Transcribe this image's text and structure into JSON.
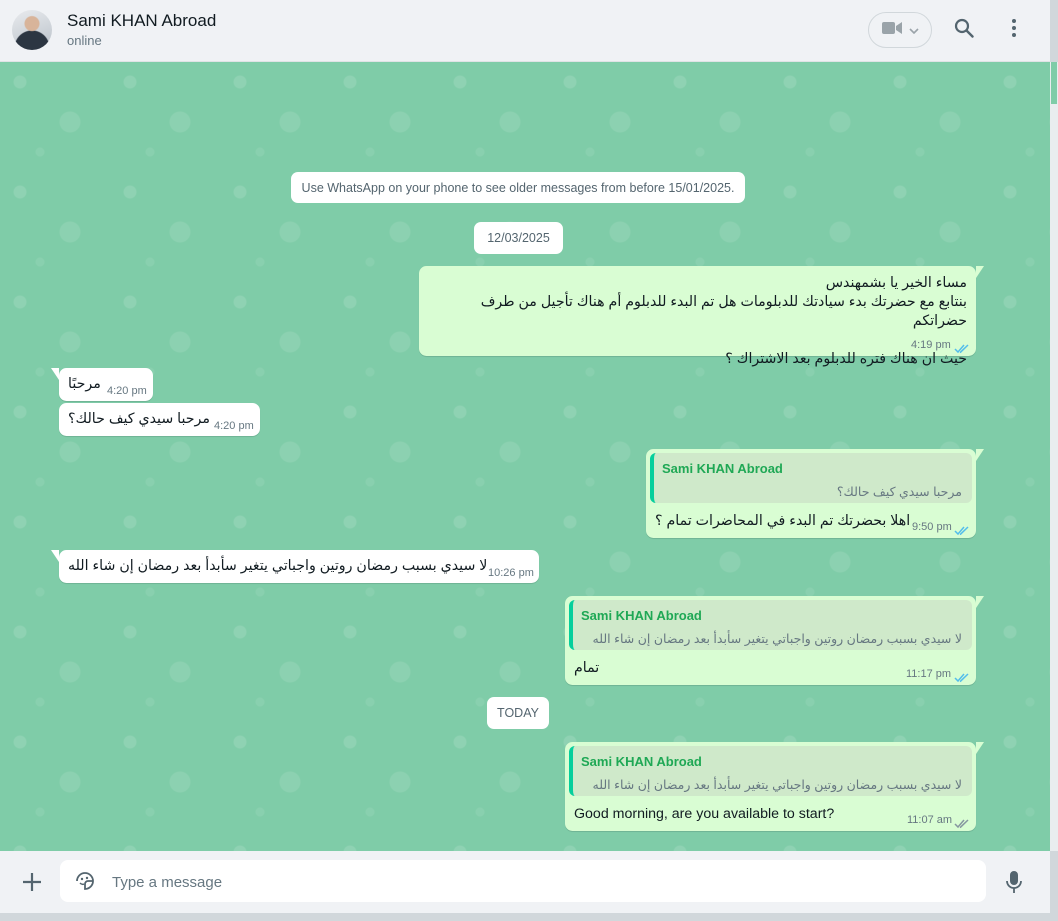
{
  "header": {
    "contact_name": "Sami KHAN Abroad",
    "status": "online"
  },
  "notice": "Use WhatsApp on your phone to see older messages from before 15/01/2025.",
  "date_chips": [
    "12/03/2025",
    "TODAY"
  ],
  "messages": [
    {
      "direction": "outgoing",
      "lines": [
        "مساء الخير يا بشمهندس",
        "بنتابع مع حضرتك بدء سيادتك للدبلومات هل تم البدء للدبلوم أم هناك تأجيل من طرف حضراتكم",
        "",
        "حيث ان هناك فتره للدبلوم بعد الاشتراك ؟"
      ],
      "time": "4:19 pm",
      "status": "read"
    },
    {
      "direction": "incoming",
      "text": "مرحبًا",
      "time": "4:20 pm"
    },
    {
      "direction": "incoming",
      "text": "مرحبا سيدي كيف حالك؟",
      "time": "4:20 pm"
    },
    {
      "direction": "outgoing",
      "quote": {
        "author": "Sami KHAN Abroad",
        "text": "مرحبا سيدي كيف حالك؟"
      },
      "text": "اهلا بحضرتك تم البدء في المحاضرات تمام ؟",
      "time": "9:50 pm",
      "status": "read"
    },
    {
      "direction": "incoming",
      "text": "لا سيدي بسبب رمضان روتين واجباتي يتغير سأبدأ بعد رمضان إن شاء الله",
      "time": "10:26 pm"
    },
    {
      "direction": "outgoing",
      "quote": {
        "author": "Sami KHAN Abroad",
        "text": "لا سيدي بسبب رمضان روتين واجباتي يتغير سأبدأ بعد رمضان إن شاء الله"
      },
      "text": "تمام",
      "time": "11:17 pm",
      "status": "read"
    },
    {
      "direction": "outgoing",
      "quote": {
        "author": "Sami KHAN Abroad",
        "text": "لا سيدي بسبب رمضان روتين واجباتي يتغير سأبدأ بعد رمضان إن شاء الله"
      },
      "text": "Good morning, are you available to start?",
      "time": "11:07 am",
      "status": "delivered"
    }
  ],
  "composer": {
    "placeholder": "Type a message"
  },
  "icons": {
    "video": "video-camera-icon",
    "search": "search-icon",
    "menu": "menu-dots-icon",
    "attach": "plus-icon",
    "sticker": "sticker-icon",
    "mic": "microphone-icon"
  },
  "colors": {
    "chat_background": "#7fcca8",
    "outgoing_bubble": "#d9fdd3",
    "incoming_bubble": "#ffffff",
    "read_ticks": "#53bdeb",
    "quote_author": "#1fa855"
  }
}
